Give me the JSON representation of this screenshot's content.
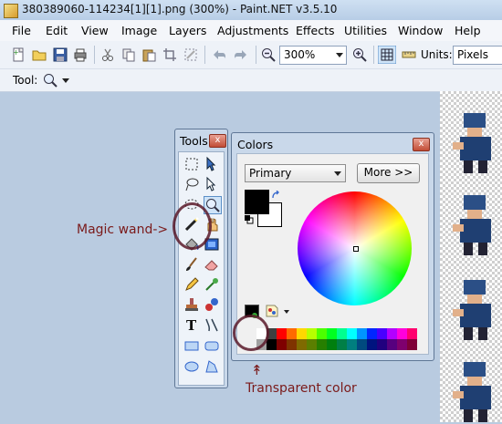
{
  "window": {
    "title": "380389060-114234[1][1].png (300%) - Paint.NET v3.5.10"
  },
  "menu": {
    "items": [
      "File",
      "Edit",
      "View",
      "Image",
      "Layers",
      "Adjustments",
      "Effects",
      "Utilities",
      "Window",
      "Help"
    ]
  },
  "toolbar": {
    "zoom_value": "300%",
    "units_label": "Units:",
    "units_value": "Pixels"
  },
  "toolrow": {
    "label": "Tool:"
  },
  "tools_window": {
    "title": "Tools",
    "close": "x"
  },
  "colors_window": {
    "title": "Colors",
    "close": "x",
    "mode_value": "Primary",
    "more_button": "More >>",
    "palette_colors": [
      [
        "#ffffff",
        "#404040",
        "#ff0000",
        "#ff6a00",
        "#ffd800",
        "#b6ff00",
        "#4cff00",
        "#00ff21",
        "#00ff90",
        "#00ffff",
        "#0094ff",
        "#0026ff",
        "#4800ff",
        "#b200ff",
        "#ff00dc",
        "#ff006e"
      ],
      [
        "#a0a0a0",
        "#000000",
        "#7f0000",
        "#7f3300",
        "#7f6a00",
        "#5b7f00",
        "#267f00",
        "#007f0e",
        "#007f46",
        "#007f7f",
        "#004a7f",
        "#00137f",
        "#21007f",
        "#57007f",
        "#7f006e",
        "#7f0037"
      ]
    ]
  },
  "annotations": {
    "magic_wand": "Magic wand->",
    "transparent_color": "Transparent color",
    "arrow_up": "↟"
  },
  "colors": {
    "annotation": "#7a1a1a",
    "window_frame": "#c9d8ea"
  }
}
